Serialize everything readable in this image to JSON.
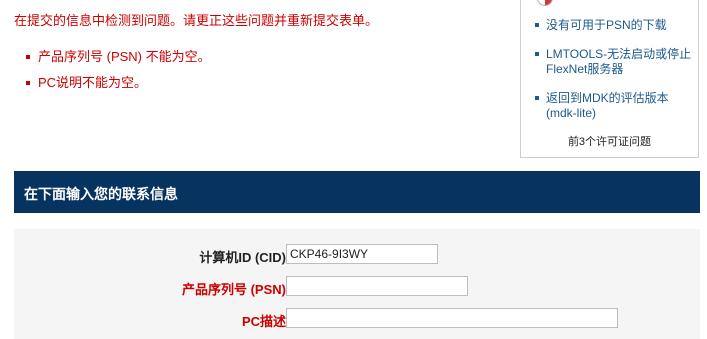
{
  "errors": {
    "summary": "在提交的信息中检测到问题。请更正这些问题并重新提交表单。",
    "items": [
      "产品序列号 (PSN) 不能为空。",
      "PC说明不能为空。"
    ]
  },
  "sidebar": {
    "links": [
      "没有可用于PSN的下载",
      "LMTOOLS-无法启动或停止FlexNet服务器",
      "返回到MDK的评估版本(mdk-lite)"
    ],
    "footer": "前3个许可证问题"
  },
  "contact": {
    "title": "在下面输入您的联系信息",
    "fields": {
      "cid": {
        "label": "计算机ID (CID)",
        "value": "CKP46-9I3WY"
      },
      "psn": {
        "label": "产品序列号 (PSN)",
        "value": ""
      },
      "pc": {
        "label": "PC描述",
        "value": ""
      }
    },
    "colon": ":"
  },
  "colors": {
    "error": "#cc0000",
    "link": "#1d5a8c",
    "header_bg": "#06335f"
  }
}
